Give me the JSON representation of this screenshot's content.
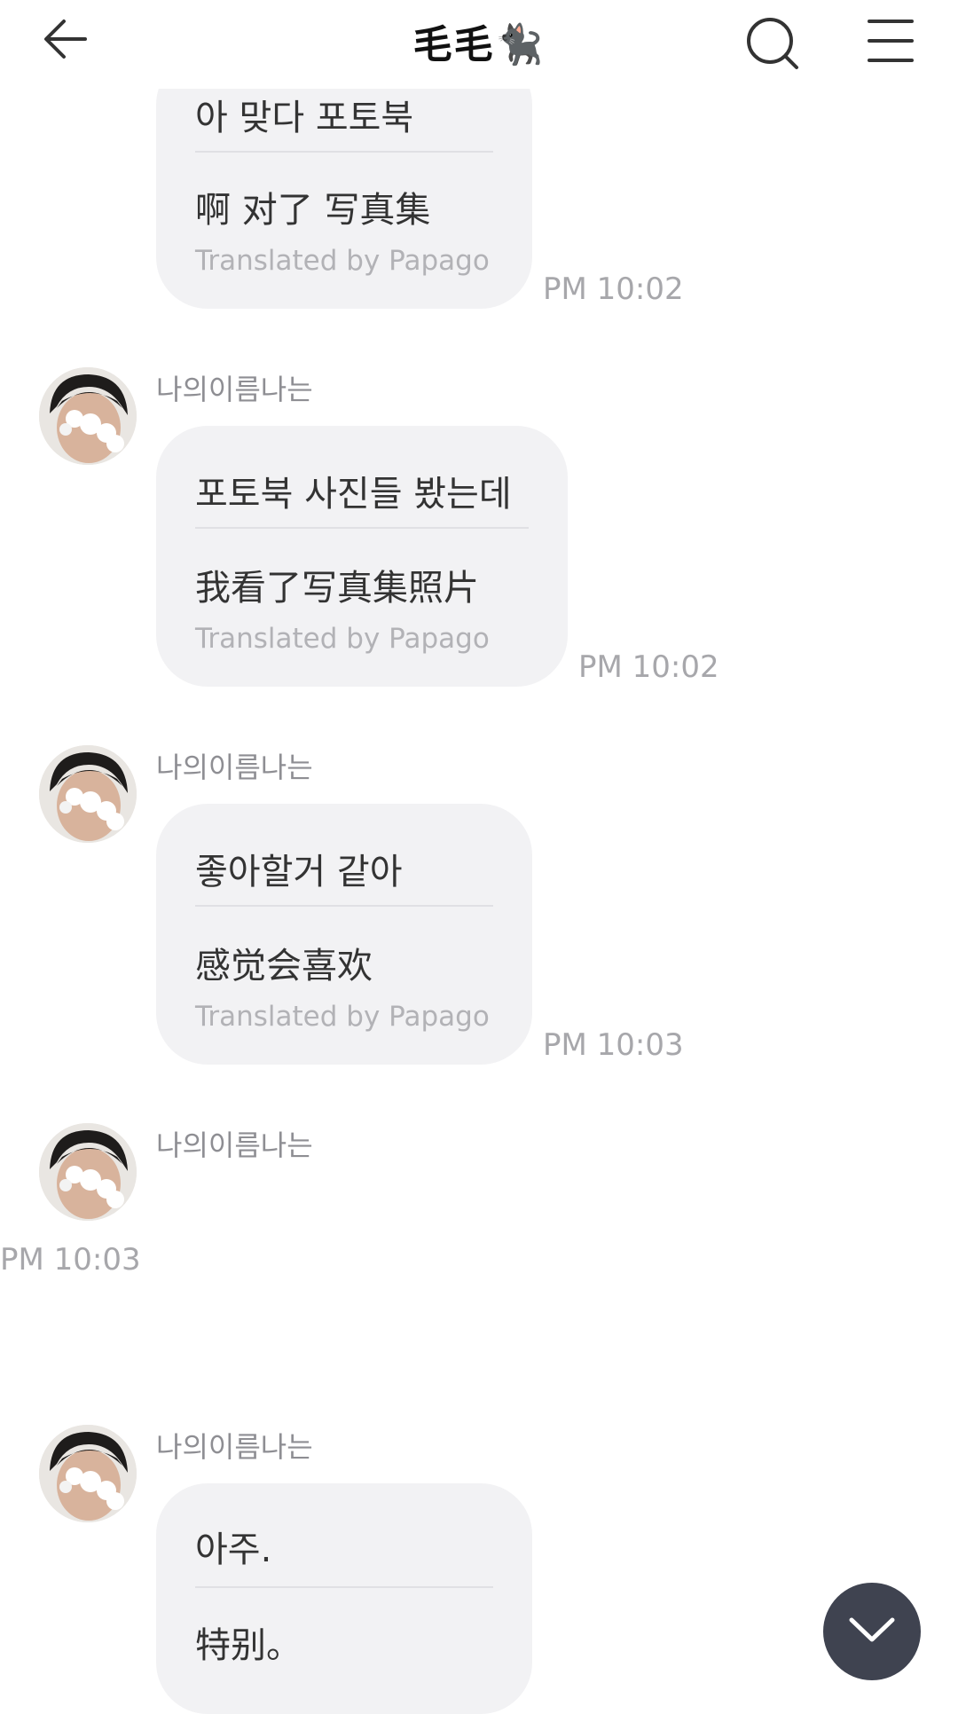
{
  "header": {
    "title": "毛毛🐈‍⬛",
    "back_icon": "arrow-left-icon",
    "search_icon": "search-icon",
    "menu_icon": "hamburger-menu-icon"
  },
  "messages": [
    {
      "sender": "",
      "original": "아 맞다 포토북",
      "translation": "啊 对了 写真集",
      "credit": "Translated by Papago",
      "time": "PM 10:02"
    },
    {
      "sender": "나의이름나는",
      "original": "포토북 사진들 봤는데",
      "translation": "我看了写真集照片",
      "credit": "Translated by Papago",
      "time": "PM 10:02"
    },
    {
      "sender": "나의이름나는",
      "original": "좋아할거 같아",
      "translation": "感觉会喜欢",
      "credit": "Translated by Papago",
      "time": "PM 10:03"
    },
    {
      "sender": "나의이름나는",
      "time": "PM 10:03"
    },
    {
      "sender": "나의이름나는",
      "original": "아주.",
      "translation": "特别。"
    }
  ],
  "scroll_down_icon": "chevron-down-icon",
  "colors": {
    "bubble": "#f2f2f4",
    "fab": "#3f4350",
    "muted": "#a7a7ab"
  }
}
